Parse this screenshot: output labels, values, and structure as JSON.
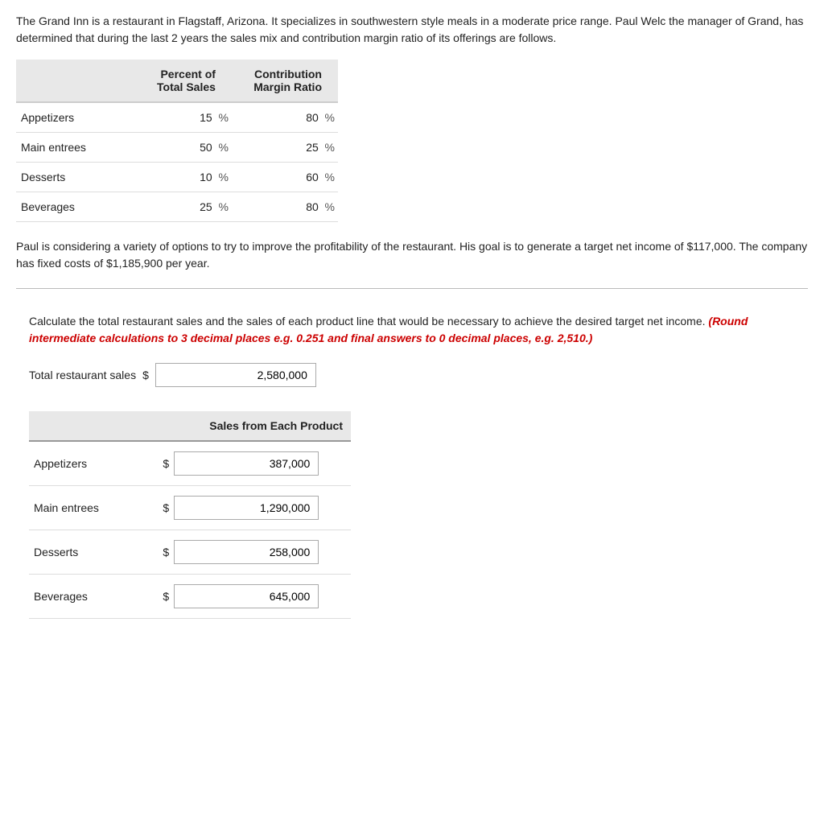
{
  "intro": {
    "text": "The Grand Inn is a restaurant in Flagstaff, Arizona. It specializes in southwestern style meals in a moderate price range. Paul Welc the manager of Grand, has determined that during the last 2 years the sales mix and contribution margin ratio of its offerings are follows."
  },
  "table": {
    "col1_header_line1": "Percent of",
    "col1_header_line2": "Total Sales",
    "col2_header_line1": "Contribution",
    "col2_header_line2": "Margin Ratio",
    "rows": [
      {
        "label": "Appetizers",
        "pct": "15",
        "pct_sign": "%",
        "ratio": "80",
        "ratio_sign": "%"
      },
      {
        "label": "Main entrees",
        "pct": "50",
        "pct_sign": "%",
        "ratio": "25",
        "ratio_sign": "%"
      },
      {
        "label": "Desserts",
        "pct": "10",
        "pct_sign": "%",
        "ratio": "60",
        "ratio_sign": "%"
      },
      {
        "label": "Beverages",
        "pct": "25",
        "pct_sign": "%",
        "ratio": "80",
        "ratio_sign": "%"
      }
    ]
  },
  "middle_text": "Paul is considering a variety of options to try to improve the profitability of the restaurant. His goal is to generate a target net income of $117,000. The company has fixed costs of $1,185,900 per year.",
  "instruction": {
    "text": "Calculate the total restaurant sales and the sales of each product line that would be necessary to achieve the desired target net income.",
    "red_italic": "(Round intermediate calculations to 3 decimal places e.g. 0.251 and final answers to 0 decimal places, e.g. 2,510.)"
  },
  "total_sales": {
    "label": "Total restaurant sales",
    "dollar": "$",
    "value": "2,580,000"
  },
  "product_table": {
    "header": "Sales from Each Product",
    "rows": [
      {
        "label": "Appetizers",
        "dollar": "$",
        "value": "387,000"
      },
      {
        "label": "Main entrees",
        "dollar": "$",
        "value": "1,290,000"
      },
      {
        "label": "Desserts",
        "dollar": "$",
        "value": "258,000"
      },
      {
        "label": "Beverages",
        "dollar": "$",
        "value": "645,000"
      }
    ]
  }
}
